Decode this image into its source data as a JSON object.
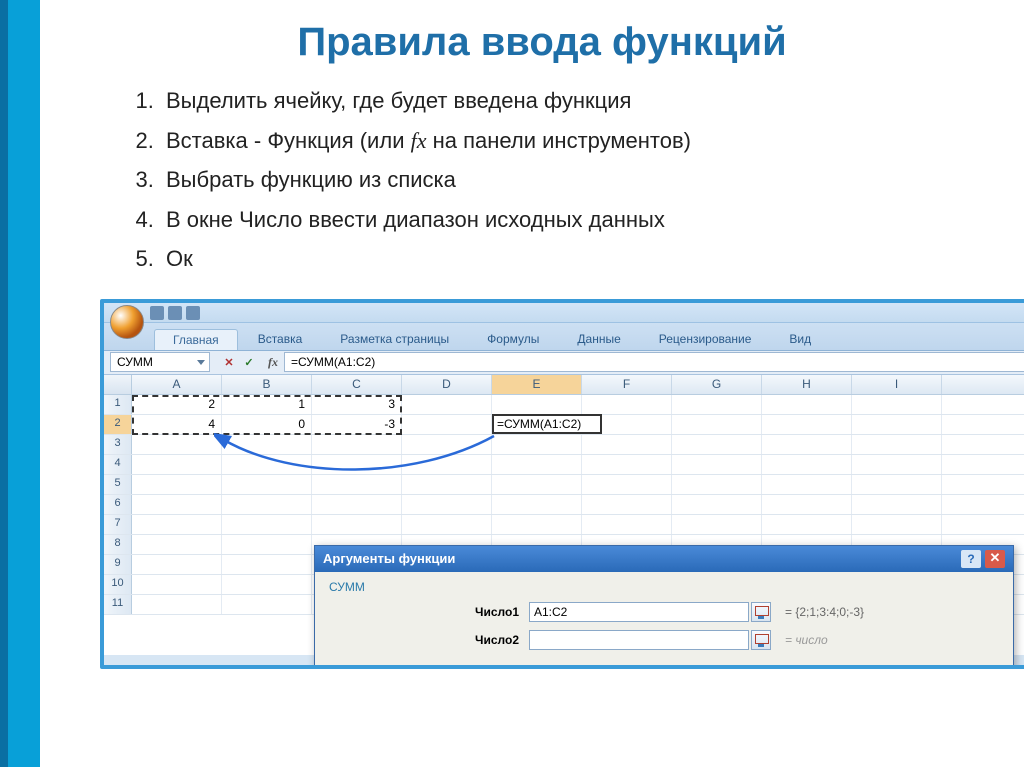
{
  "title": "Правила ввода функций",
  "steps": [
    "Выделить ячейку, где будет введена функция",
    "Вставка - Функция (или ",
    "Выбрать функцию из списка",
    "В окне Число ввести диапазон исходных данных",
    "Ок"
  ],
  "step2_fx": "fx",
  "step2_tail": " на панели инструментов)",
  "excel": {
    "tabs": [
      "Главная",
      "Вставка",
      "Разметка страницы",
      "Формулы",
      "Данные",
      "Рецензирование",
      "Вид"
    ],
    "active_tab": 0,
    "namebox": "СУММ",
    "formula": "=СУММ(A1:C2)",
    "columns": [
      "A",
      "B",
      "C",
      "D",
      "E",
      "F",
      "G",
      "H",
      "I"
    ],
    "data": {
      "r1": {
        "A": "2",
        "B": "1",
        "C": "3"
      },
      "r2": {
        "A": "4",
        "B": "0",
        "C": "-3"
      }
    },
    "active_cell_row": 2,
    "active_cell_col": "E",
    "active_cell_text": "=СУММ(A1:C2)",
    "marquee_range": "A1:C2"
  },
  "dialog": {
    "title": "Аргументы функции",
    "func_name": "СУММ",
    "rows": [
      {
        "label": "Число1",
        "value": "A1:C2",
        "result": "= {2;1;3:4;0;-3}"
      },
      {
        "label": "Число2",
        "value": "",
        "result": "= число"
      }
    ]
  }
}
